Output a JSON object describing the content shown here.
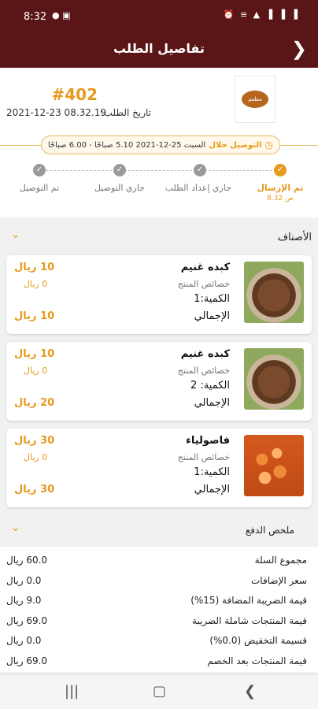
{
  "status_bar": {
    "time": "8:32",
    "left_icons": "● ▣",
    "right_icons": "⏰ ≡ ▲ ▐ ▐ ▐"
  },
  "app_bar": {
    "title": "تفاصيل الطلب",
    "back_icon": "❯"
  },
  "order": {
    "number": "#402",
    "date_label": "تاريخ الطلب:",
    "date_value": "2021-12-23 08.32.19",
    "logo_text": "مطعم",
    "delivery_label": "التوصيل خلال",
    "delivery_value": "السبت 25-12-2021 5.10 صباحًا - 6.00 صباحًا"
  },
  "steps": [
    {
      "label": "تم الإرسال",
      "time": "8.32 ص",
      "done": true
    },
    {
      "label": "جاري إعداد الطلب",
      "time": "",
      "done": false
    },
    {
      "label": "جاري التوصيل",
      "time": "",
      "done": false
    },
    {
      "label": "تم التوصيل",
      "time": "",
      "done": false
    }
  ],
  "items_section": {
    "title": "الأصناف"
  },
  "items": [
    {
      "name": "كبده غنيم",
      "price": "10 ريال",
      "props_label": "خصائص المنتج",
      "props_price": "0 ريال",
      "qty": "الكمية:1",
      "total_label": "الإجمالي",
      "total": "10 ريال",
      "image": "liver"
    },
    {
      "name": "كبده غنيم",
      "price": "10 ريال",
      "props_label": "خصائص المنتج",
      "props_price": "0 ريال",
      "qty": "الكمية: 2",
      "total_label": "الإجمالي",
      "total": "20 ريال",
      "image": "liver"
    },
    {
      "name": "فاصولياء",
      "price": "30 ريال",
      "props_label": "خصائص المنتج",
      "props_price": "0 ريال",
      "qty": "الكمية:1",
      "total_label": "الإجمالي",
      "total": "30 ريال",
      "image": "beans"
    }
  ],
  "summary_section": {
    "title": "ملخص الدفع"
  },
  "summary": [
    {
      "label": "مجموع السلة",
      "value": "60.0 ريال"
    },
    {
      "label": "سعر الإضافات",
      "value": "0.0 ريال"
    },
    {
      "label": "قيمة الضريبة المضافة (15%)",
      "value": "9.0 ريال"
    },
    {
      "label": "قيمة المنتجات شاملة الضريبة",
      "value": "69.0 ريال"
    },
    {
      "label": "قسيمة التخفيض (0.0%)",
      "value": "0.0 ريال"
    },
    {
      "label": "قيمة المنتجات بعد الخصم",
      "value": "69.0 ريال"
    }
  ],
  "nav": {
    "recents": "|||",
    "home": "▢",
    "back": "❮"
  },
  "colors": {
    "primary": "#5a1616",
    "accent": "#e69a1e"
  }
}
